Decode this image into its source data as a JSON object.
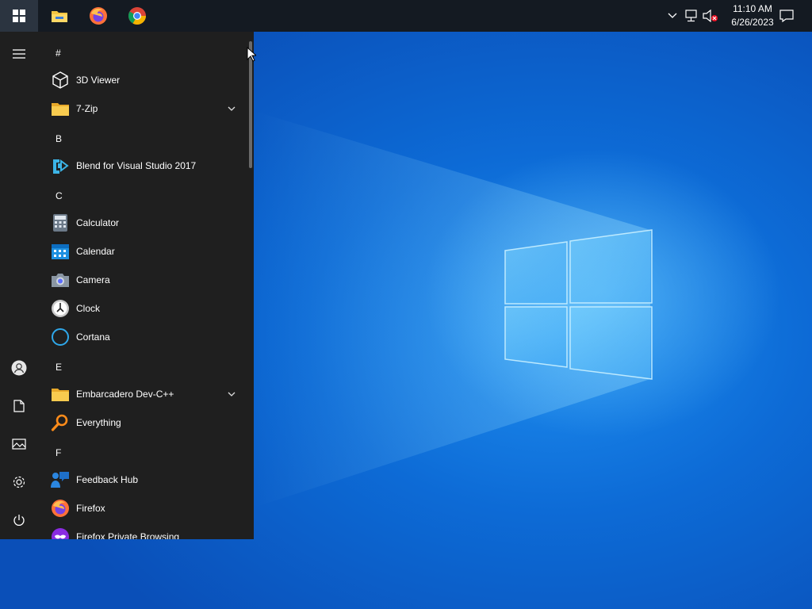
{
  "taskbar": {
    "pinned": [
      {
        "name": "File Explorer",
        "icon": "folder-icon"
      },
      {
        "name": "Firefox",
        "icon": "firefox-icon"
      },
      {
        "name": "Google Chrome",
        "icon": "chrome-icon"
      }
    ],
    "clock": {
      "time": "11:10 AM",
      "date": "6/26/2023"
    },
    "tray_icons": [
      "chevron-up-icon",
      "network-icon",
      "volume-muted-icon",
      "notification-icon"
    ]
  },
  "start_menu": {
    "groups": [
      {
        "header": "#",
        "apps": [
          {
            "label": "3D Viewer",
            "icon": "cube-icon"
          },
          {
            "label": "7-Zip",
            "icon": "folder-icon",
            "expandable": true
          }
        ]
      },
      {
        "header": "B",
        "apps": [
          {
            "label": "Blend for Visual Studio 2017",
            "icon": "blend-icon"
          }
        ]
      },
      {
        "header": "C",
        "apps": [
          {
            "label": "Calculator",
            "icon": "calculator-icon"
          },
          {
            "label": "Calendar",
            "icon": "calendar-icon"
          },
          {
            "label": "Camera",
            "icon": "camera-icon"
          },
          {
            "label": "Clock",
            "icon": "clock-icon"
          },
          {
            "label": "Cortana",
            "icon": "cortana-icon"
          }
        ]
      },
      {
        "header": "E",
        "apps": [
          {
            "label": "Embarcadero Dev-C++",
            "icon": "folder-icon",
            "expandable": true
          },
          {
            "label": "Everything",
            "icon": "magnifier-icon"
          }
        ]
      },
      {
        "header": "F",
        "apps": [
          {
            "label": "Feedback Hub",
            "icon": "feedback-icon"
          },
          {
            "label": "Firefox",
            "icon": "firefox-icon"
          },
          {
            "label": "Firefox Private Browsing",
            "icon": "firefox-private-icon"
          }
        ]
      }
    ],
    "rail": [
      "hamburger-icon",
      "user-icon",
      "documents-icon",
      "pictures-icon",
      "settings-icon",
      "power-icon"
    ]
  },
  "colors": {
    "taskbar": "#141a22",
    "start_menu": "#1f1f1f",
    "desktop": "#0a6bd6",
    "folder": "#f4c542"
  }
}
